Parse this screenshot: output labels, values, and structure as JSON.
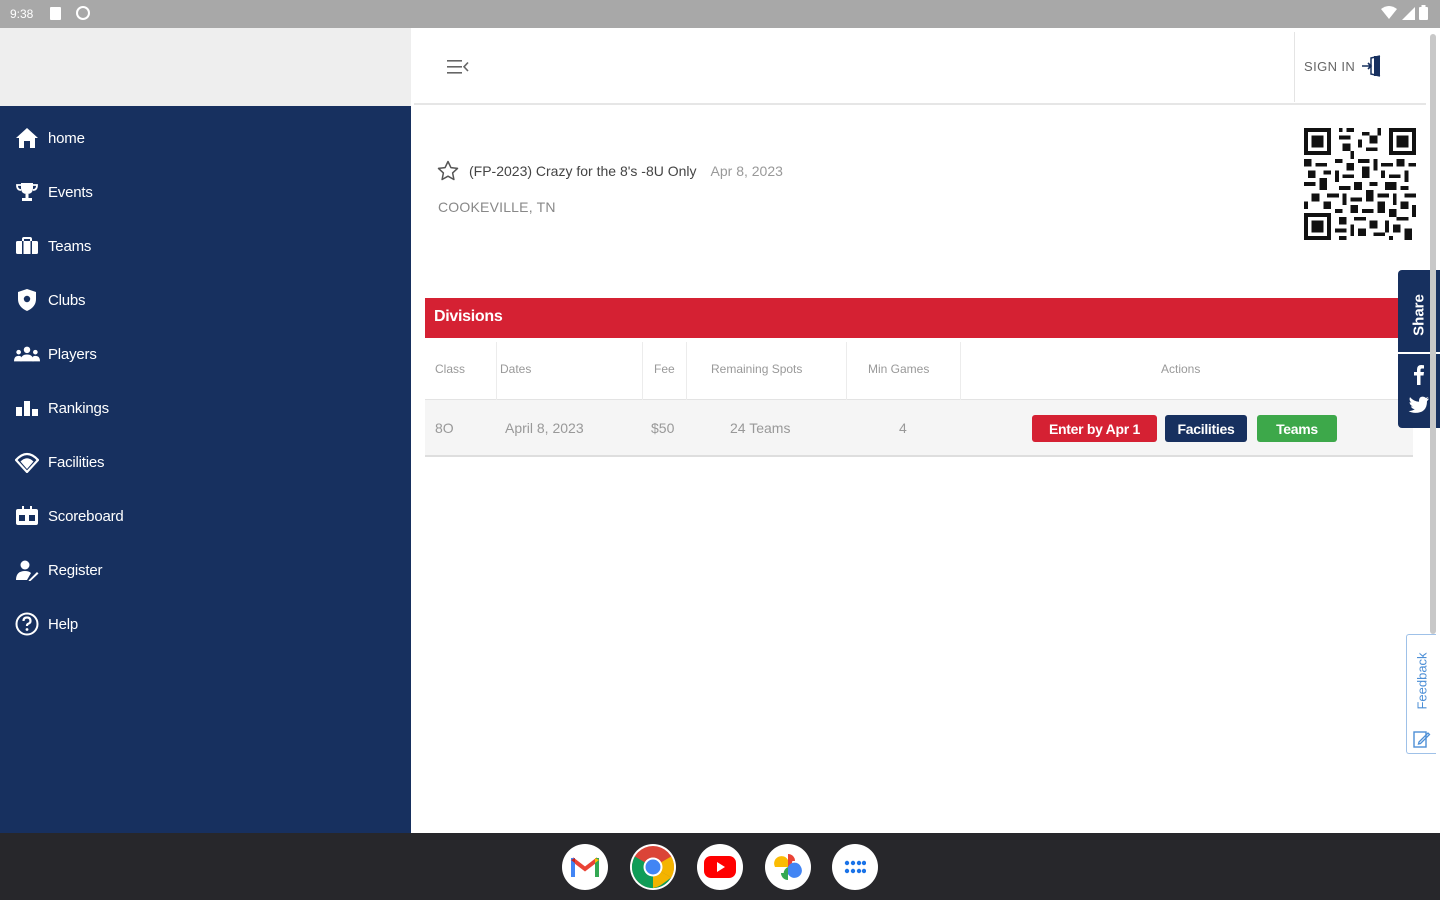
{
  "status_bar": {
    "time": "9:38"
  },
  "sidebar": {
    "items": [
      {
        "label": "home",
        "icon": "home-icon"
      },
      {
        "label": "Events",
        "icon": "trophy-icon"
      },
      {
        "label": "Teams",
        "icon": "teams-icon"
      },
      {
        "label": "Clubs",
        "icon": "shield-icon"
      },
      {
        "label": "Players",
        "icon": "players-icon"
      },
      {
        "label": "Rankings",
        "icon": "rankings-icon"
      },
      {
        "label": "Facilities",
        "icon": "facilities-icon"
      },
      {
        "label": "Scoreboard",
        "icon": "scoreboard-icon"
      },
      {
        "label": "Register",
        "icon": "register-icon"
      },
      {
        "label": "Help",
        "icon": "help-icon"
      }
    ]
  },
  "header": {
    "signin_label": "SIGN IN"
  },
  "event": {
    "title": "(FP-2023) Crazy for the 8's -8U Only",
    "date": "Apr 8, 2023",
    "location": "COOKEVILLE, TN"
  },
  "divisions": {
    "title": "Divisions",
    "columns": [
      "Class",
      "Dates",
      "Fee",
      "Remaining Spots",
      "Min Games",
      "Actions"
    ],
    "rows": [
      {
        "class": "8O",
        "dates": "April 8, 2023",
        "fee": "$50",
        "remaining": "24 Teams",
        "min_games": "4",
        "actions": [
          "Enter by Apr 1",
          "Facilities",
          "Teams"
        ]
      }
    ]
  },
  "share": {
    "label": "Share"
  },
  "feedback": {
    "label": "Feedback"
  },
  "taskbar": {
    "apps": [
      "Gmail",
      "Chrome",
      "YouTube",
      "Photos",
      "App drawer"
    ]
  },
  "colors": {
    "navy": "#17305f",
    "red": "#d52133",
    "green": "#3da84a"
  }
}
